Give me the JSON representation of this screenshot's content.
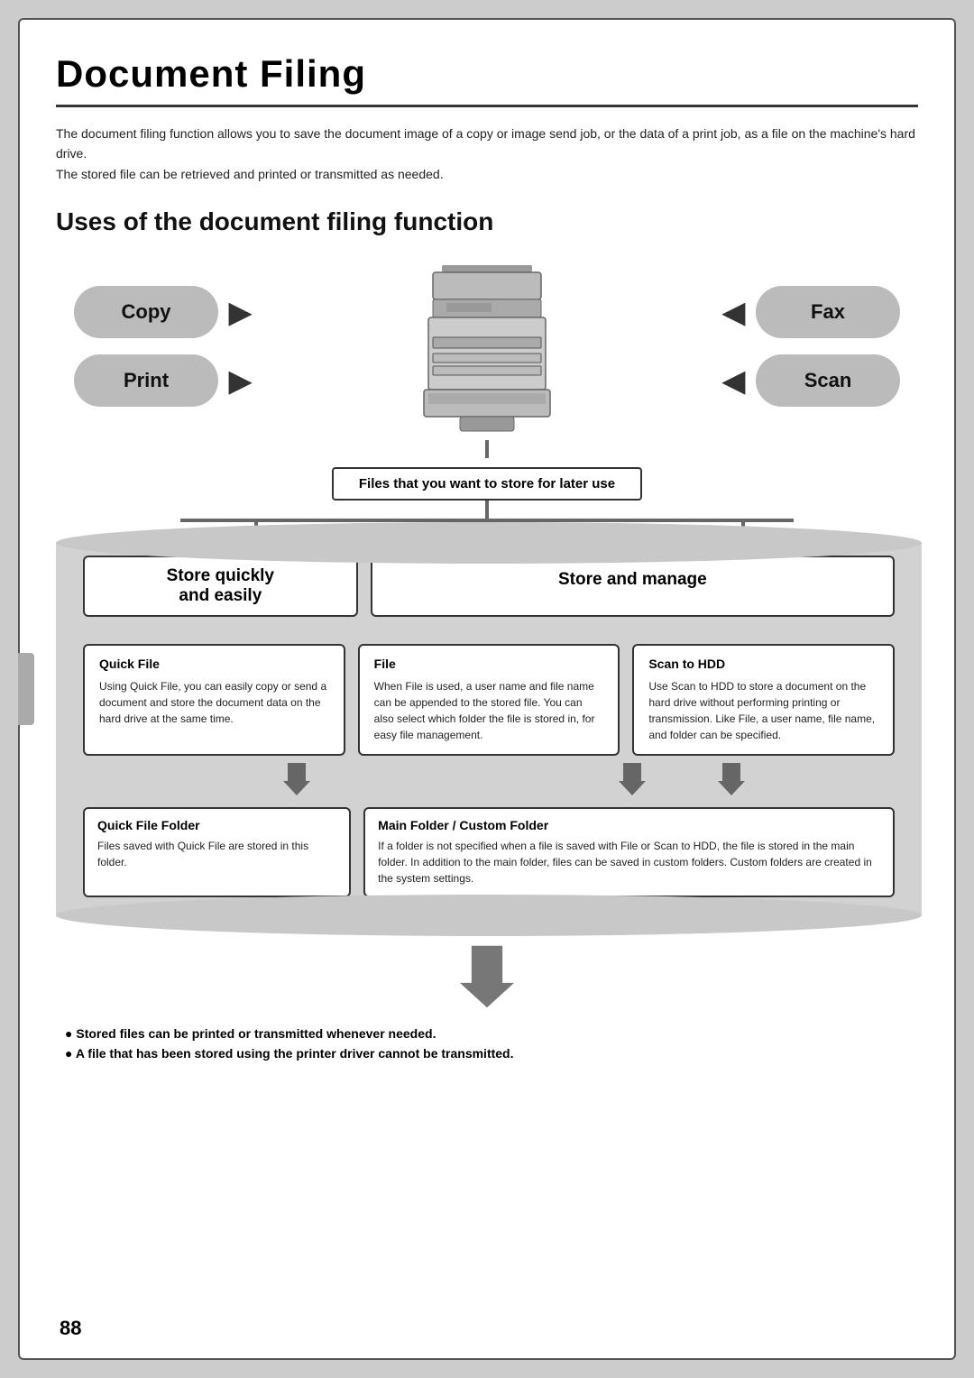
{
  "page": {
    "title": "Document Filing",
    "intro": [
      "The document filing function allows you to save the document image of a copy or image send job, or the data of a print job, as a file on the machine's hard drive.",
      "The stored file can be retrieved and printed or transmitted as needed."
    ],
    "section_title": "Uses of the document filing function",
    "input_labels": {
      "copy": "Copy",
      "print": "Print",
      "fax": "Fax",
      "scan": "Scan"
    },
    "files_label": "Files that you want to store for later use",
    "store_labels": {
      "quickly": "Store quickly\nand easily",
      "manage": "Store and manage"
    },
    "boxes": {
      "quick_file": {
        "title": "Quick File",
        "text": "Using Quick File, you can easily copy or send a document and store the document data on the hard drive at the same time."
      },
      "file": {
        "title": "File",
        "text": "When File is used, a user name and file name can be appended to the stored file. You can also select which folder the file is stored in, for easy file management."
      },
      "scan_to_hdd": {
        "title": "Scan to HDD",
        "text": "Use Scan to HDD to store a document on the hard drive without performing printing or transmission. Like File, a user name, file name, and folder can be specified."
      }
    },
    "folders": {
      "quick_file_folder": {
        "title": "Quick File Folder",
        "text": "Files saved with Quick File are stored in this folder."
      },
      "main_folder": {
        "title": "Main Folder / Custom Folder",
        "text": "If a folder is not specified when a file is saved with File or Scan to HDD, the file is stored in the main folder. In addition to the main folder, files can be saved in custom folders. Custom folders are created in the system settings."
      }
    },
    "bottom_notes": {
      "note1": "Stored files can be printed or transmitted whenever needed.",
      "note2": "A file that has been stored using the printer driver cannot be transmitted."
    },
    "page_number": "88"
  }
}
